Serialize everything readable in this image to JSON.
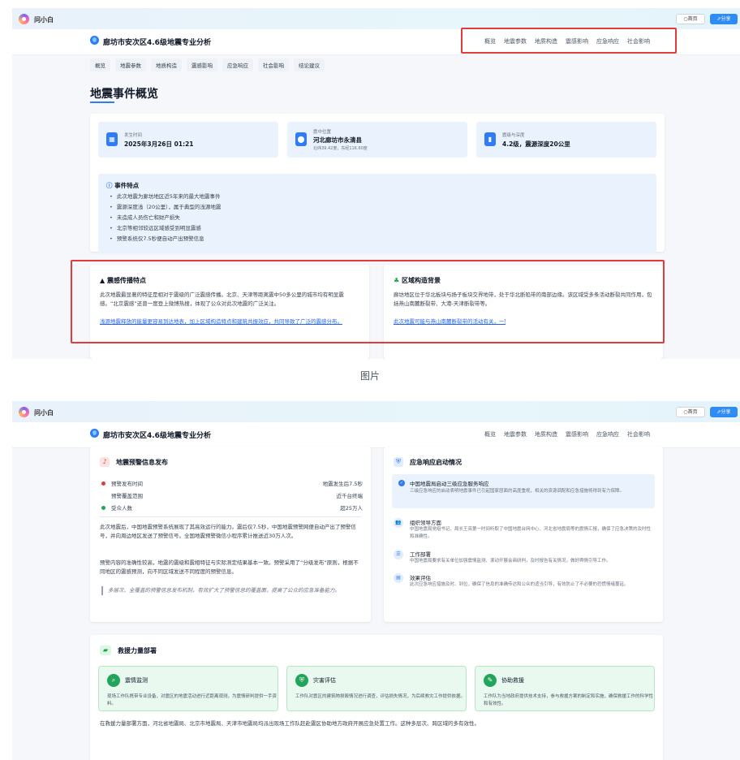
{
  "app": {
    "name": "问小白",
    "home_label": "○首页",
    "share_label": "⇗分享"
  },
  "report": {
    "title": "廊坊市安次区4.6级地震专业分析"
  },
  "top_nav": [
    "概览",
    "地震参数",
    "地质构造",
    "震感影响",
    "应急响应",
    "社会影响"
  ],
  "sub_tabs": [
    "概览",
    "地震参数",
    "地质构造",
    "震感影响",
    "应急响应",
    "社会影响",
    "结论建议"
  ],
  "overview": {
    "heading": "地震事件概览",
    "stats": [
      {
        "icon": "calendar-icon",
        "label": "发生时间",
        "value": "2025年3月26日 01:21",
        "sub": ""
      },
      {
        "icon": "map-pin-icon",
        "label": "震中位置",
        "value": "河北廊坊市永清县",
        "sub": "北纬39.42度，东经116.60度"
      },
      {
        "icon": "gauge-icon",
        "label": "震级与深度",
        "value": "4.2级，震源深度20公里",
        "sub": ""
      }
    ],
    "features_title": "事件特点",
    "features": [
      "此次地震为廊坊地区近5年来的最大地震事件",
      "震源深度浅（20公里），属于典型的浅源地震",
      "未造成人员伤亡和财产损失",
      "北京等相邻较远区域感受到明显震感",
      "预警系统仅7.5秒便自动产出预警信息"
    ]
  },
  "spread": {
    "title": "震感传播特点",
    "text": "此次地震最显著的特征是相对于震级的广泛震感传播。北京、天津等距离震中50多公里的城市均有明显震感。“北京震感”还曾一度登上微博热搜，体现了公众对此次地震的广泛关注。",
    "link": "浅源地震释放的能量更容易到达地表，加上区域构造特点和建筑共振效应，共同导致了广泛的震感分布。"
  },
  "tectonic": {
    "title": "区域构造背景",
    "text": "廊坊地区位于华北板块与扬子板块交界地带，处于华北断陷带的南部边缘。该区域受多条活动断裂共同作用，包括燕山南麓断裂带、大港-天津断裂带等。",
    "link": "此次地震可能与燕山南麓断裂带的活动有关，一致。"
  },
  "caption": "图片",
  "warning": {
    "title": "地震预警信息发布",
    "rows": [
      {
        "key": "预警发布时间",
        "value": "地震发生后7.5秒",
        "color": "#e23b3b"
      },
      {
        "key": "预警覆盖范围",
        "value": "近千台终端",
        "color": ""
      },
      {
        "key": "受众人数",
        "value": "超25万人",
        "color": "#22a55a"
      }
    ],
    "para1": "此次地震后，中国地震预警系统展现了其高效运行的能力。震后仅7.5秒，中国地震预警网便自动产出了预警信号，并向周边地区发送了预警信号。全国地震预警微信小程序累计推送近30万人次。",
    "para2": "预警内容的准确性较高，地震的震级和震相特征与实际测定结果基本一致。预警采用了“分级发布”原则，根据不同地区的震感预测，向不同区域发送不同程度的预警信息。",
    "quote": "多层次、全覆盖的预警信息发布机制，有效扩大了预警信息的覆盖面，提高了公众的应急准备能力。"
  },
  "emergency": {
    "title": "应急响应启动情况",
    "highlight_title": "中国地震局启动三级应急服务响应",
    "highlight_text": "三级应急响应的启动表明地震事件已引起国家层面的高度重视，相关的资源调配和应急措施将得到有力保障。",
    "items": [
      {
        "icon": "people-icon",
        "glyph": "👥",
        "title": "组织领导方面",
        "text": "中国地震局党组书记、局长王亮第一时间听取了中国地震台网中心、河北省地震局等的震情汇报，确保了应急决策的及时性和准确性。"
      },
      {
        "icon": "list-icon",
        "glyph": "☰",
        "title": "工作部署",
        "text": "中国地震局要求有关单位加强震情监测、滚动开展会商研判，及时报告有关情况，做好舆情引导工作。"
      },
      {
        "icon": "clipboard-icon",
        "glyph": "▤",
        "title": "效果评估",
        "text": "此次应急响应措施及时、到位，确保了信息的准确传达和公众的适当引导，有效防止了不必要的恐慌情绪蔓延。"
      }
    ]
  },
  "rescue": {
    "title": "救援力量部署",
    "cards": [
      {
        "icon": "search-icon",
        "glyph": "⌕",
        "title": "震情监测",
        "text": "现场工作队携带专业设备，对震区的地震活动进行近距离观测，为震情研判提供一手资料。"
      },
      {
        "icon": "shield-check-icon",
        "glyph": "⛨",
        "title": "灾害评估",
        "text": "工作队对震区的建筑物损毁情况进行调查，评估损失情况，为后续救灾工作提供依据。"
      },
      {
        "icon": "handshake-icon",
        "glyph": "✎",
        "title": "协助救援",
        "text": "工作队为当地政府提供技术支持，参与救援方案的制定和实施，确保救援工作的科学性和有效性。"
      }
    ],
    "para": "在救援力量部署方面，河北省地震局、北京市地震局、天津市地震局均派出现场工作队赶赴震区协助地方政府开展应急处置工作。这种多层次、跨区域的多有效性。"
  }
}
